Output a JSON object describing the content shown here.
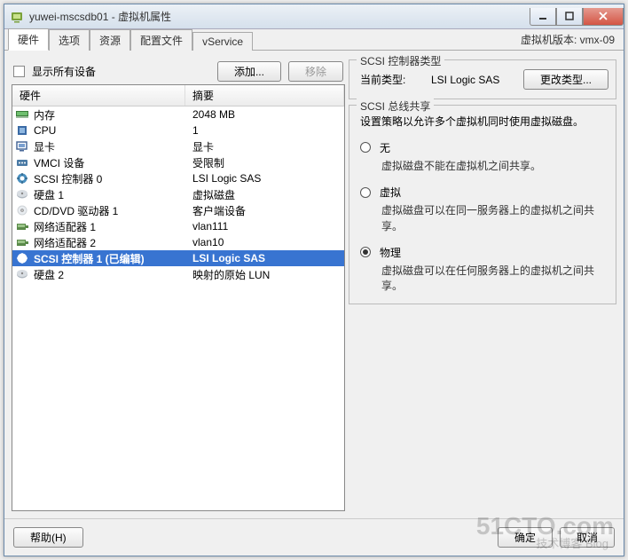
{
  "window": {
    "title": "yuwei-mscsdb01 - 虚拟机属性",
    "vm_version": "虚拟机版本: vmx-09"
  },
  "tabs": [
    "硬件",
    "选项",
    "资源",
    "配置文件",
    "vService"
  ],
  "active_tab": 0,
  "left": {
    "show_all": "显示所有设备",
    "add_btn": "添加...",
    "remove_btn": "移除",
    "cols": {
      "hw": "硬件",
      "sum": "摘要"
    },
    "rows": [
      {
        "icon": "memory-icon",
        "name": "内存",
        "summary": "2048 MB"
      },
      {
        "icon": "cpu-icon",
        "name": "CPU",
        "summary": "1"
      },
      {
        "icon": "video-icon",
        "name": "显卡",
        "summary": "显卡"
      },
      {
        "icon": "vmci-icon",
        "name": "VMCI 设备",
        "summary": "受限制"
      },
      {
        "icon": "scsi-icon",
        "name": "SCSI 控制器 0",
        "summary": "LSI Logic SAS"
      },
      {
        "icon": "disk-icon",
        "name": "硬盘 1",
        "summary": "虚拟磁盘"
      },
      {
        "icon": "cd-icon",
        "name": "CD/DVD 驱动器 1",
        "summary": "客户端设备"
      },
      {
        "icon": "nic-icon",
        "name": "网络适配器 1",
        "summary": "vlan111"
      },
      {
        "icon": "nic-icon",
        "name": "网络适配器 2",
        "summary": "vlan10"
      },
      {
        "icon": "scsi-icon",
        "name": "SCSI 控制器 1 (已编辑)",
        "summary": "LSI Logic SAS",
        "selected": true
      },
      {
        "icon": "disk-icon",
        "name": "硬盘 2",
        "summary": "映射的原始 LUN"
      }
    ]
  },
  "right": {
    "controller_box": {
      "title": "SCSI 控制器类型",
      "label": "当前类型:",
      "value": "LSI Logic SAS",
      "change_btn": "更改类型..."
    },
    "sharing_box": {
      "title": "SCSI 总线共享",
      "policy": "设置策略以允许多个虚拟机同时使用虚拟磁盘。",
      "options": [
        {
          "label": "无",
          "desc": "虚拟磁盘不能在虚拟机之间共享。",
          "checked": false
        },
        {
          "label": "虚拟",
          "desc": "虚拟磁盘可以在同一服务器上的虚拟机之间共享。",
          "checked": false
        },
        {
          "label": "物理",
          "desc": "虚拟磁盘可以在任何服务器上的虚拟机之间共享。",
          "checked": true
        }
      ]
    }
  },
  "footer": {
    "help": "帮助(H)",
    "ok": "确定",
    "cancel": "取消"
  },
  "watermark": {
    "big": "51CTO.com",
    "small": "技术博客 Blog"
  }
}
